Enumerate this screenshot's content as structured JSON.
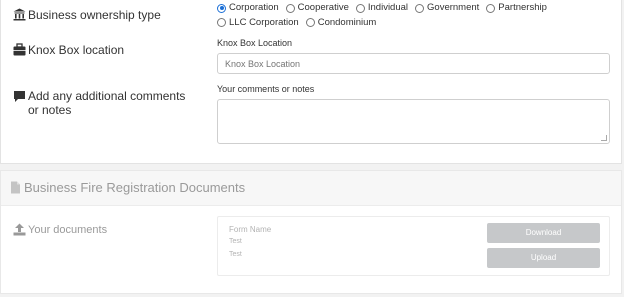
{
  "ownership": {
    "label": "Business ownership type",
    "icon": "bank-icon",
    "options": [
      {
        "label": "Corporation",
        "selected": true
      },
      {
        "label": "Cooperative",
        "selected": false
      },
      {
        "label": "Individual",
        "selected": false
      },
      {
        "label": "Government",
        "selected": false
      },
      {
        "label": "Partnership",
        "selected": false
      },
      {
        "label": "LLC Corporation",
        "selected": false
      },
      {
        "label": "Condominium",
        "selected": false
      }
    ]
  },
  "knox_box": {
    "label": "Knox Box location",
    "icon": "briefcase-icon",
    "field_label": "Knox Box Location",
    "placeholder": "Knox Box Location"
  },
  "comments": {
    "label": "Add any additional comments or notes",
    "icon": "comment-icon",
    "field_label": "Your comments or notes"
  },
  "documents_section": {
    "title": "Business Fire Registration Documents",
    "icon": "file-icon",
    "row_label": "Your documents",
    "row_icon": "upload-icon",
    "column_header": "Form Name",
    "rows": [
      "Test",
      "Test"
    ],
    "download_label": "Download",
    "upload_label": "Upload"
  },
  "colors": {
    "accent": "#1b6fd6",
    "button_disabled": "#c6c8ca"
  }
}
